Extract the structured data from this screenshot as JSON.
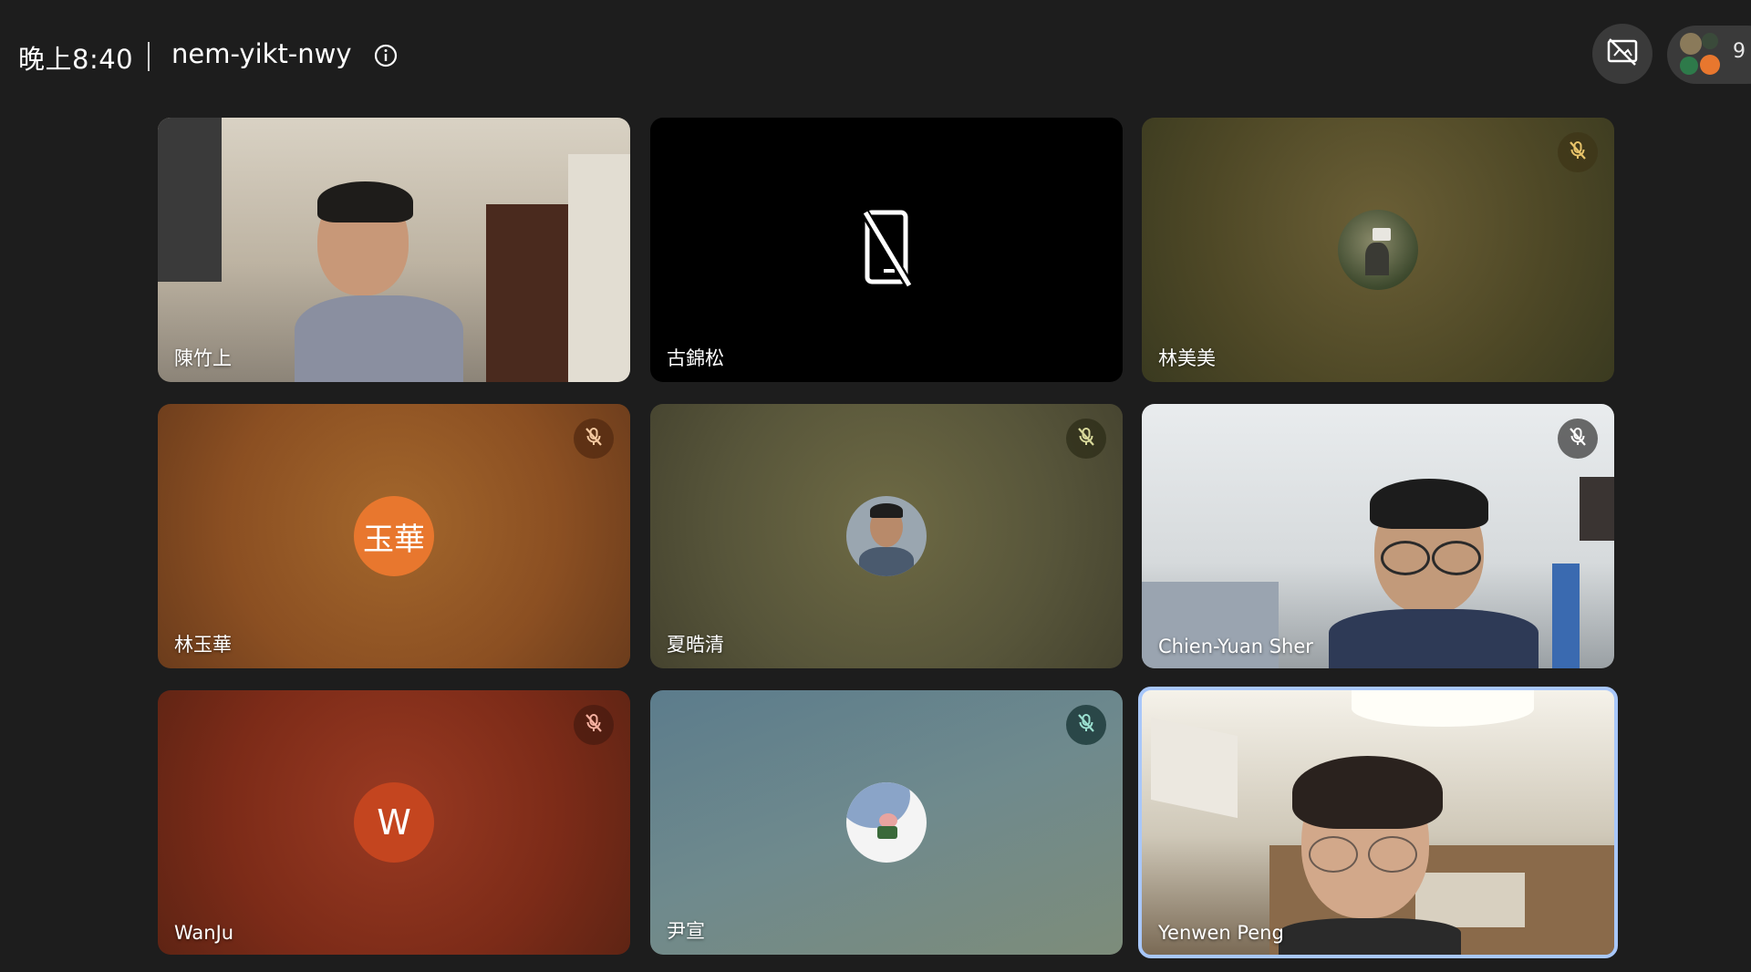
{
  "header": {
    "time": "晚上8:40",
    "meeting_code": "nem-yikt-nwy",
    "participant_count": "9"
  },
  "colors": {
    "background": "#1d1d1d",
    "active_speaker_border": "#a8c7fa"
  },
  "icons": {
    "info": "info-icon",
    "presentation": "presentation-off-icon",
    "mute": "mic-off-icon",
    "camera_off": "phone-off-icon"
  },
  "participants": [
    {
      "name": "陳竹上",
      "video": "camera",
      "muted": false
    },
    {
      "name": "古錦松",
      "video": "off",
      "muted": false
    },
    {
      "name": "林美美",
      "video": "photo-avatar",
      "muted": true
    },
    {
      "name": "林玉華",
      "video": "letter-avatar",
      "avatar_text": "玉華",
      "avatar_color": "#e8772e",
      "muted": true
    },
    {
      "name": "夏晧清",
      "video": "photo-avatar",
      "muted": true
    },
    {
      "name": "Chien-Yuan Sher",
      "video": "camera",
      "muted": true
    },
    {
      "name": "WanJu",
      "video": "letter-avatar",
      "avatar_text": "W",
      "avatar_color": "#c4451f",
      "muted": true
    },
    {
      "name": "尹宣",
      "video": "photo-avatar",
      "muted": true
    },
    {
      "name": "Yenwen Peng",
      "video": "camera",
      "muted": false,
      "active_speaker": true
    }
  ]
}
